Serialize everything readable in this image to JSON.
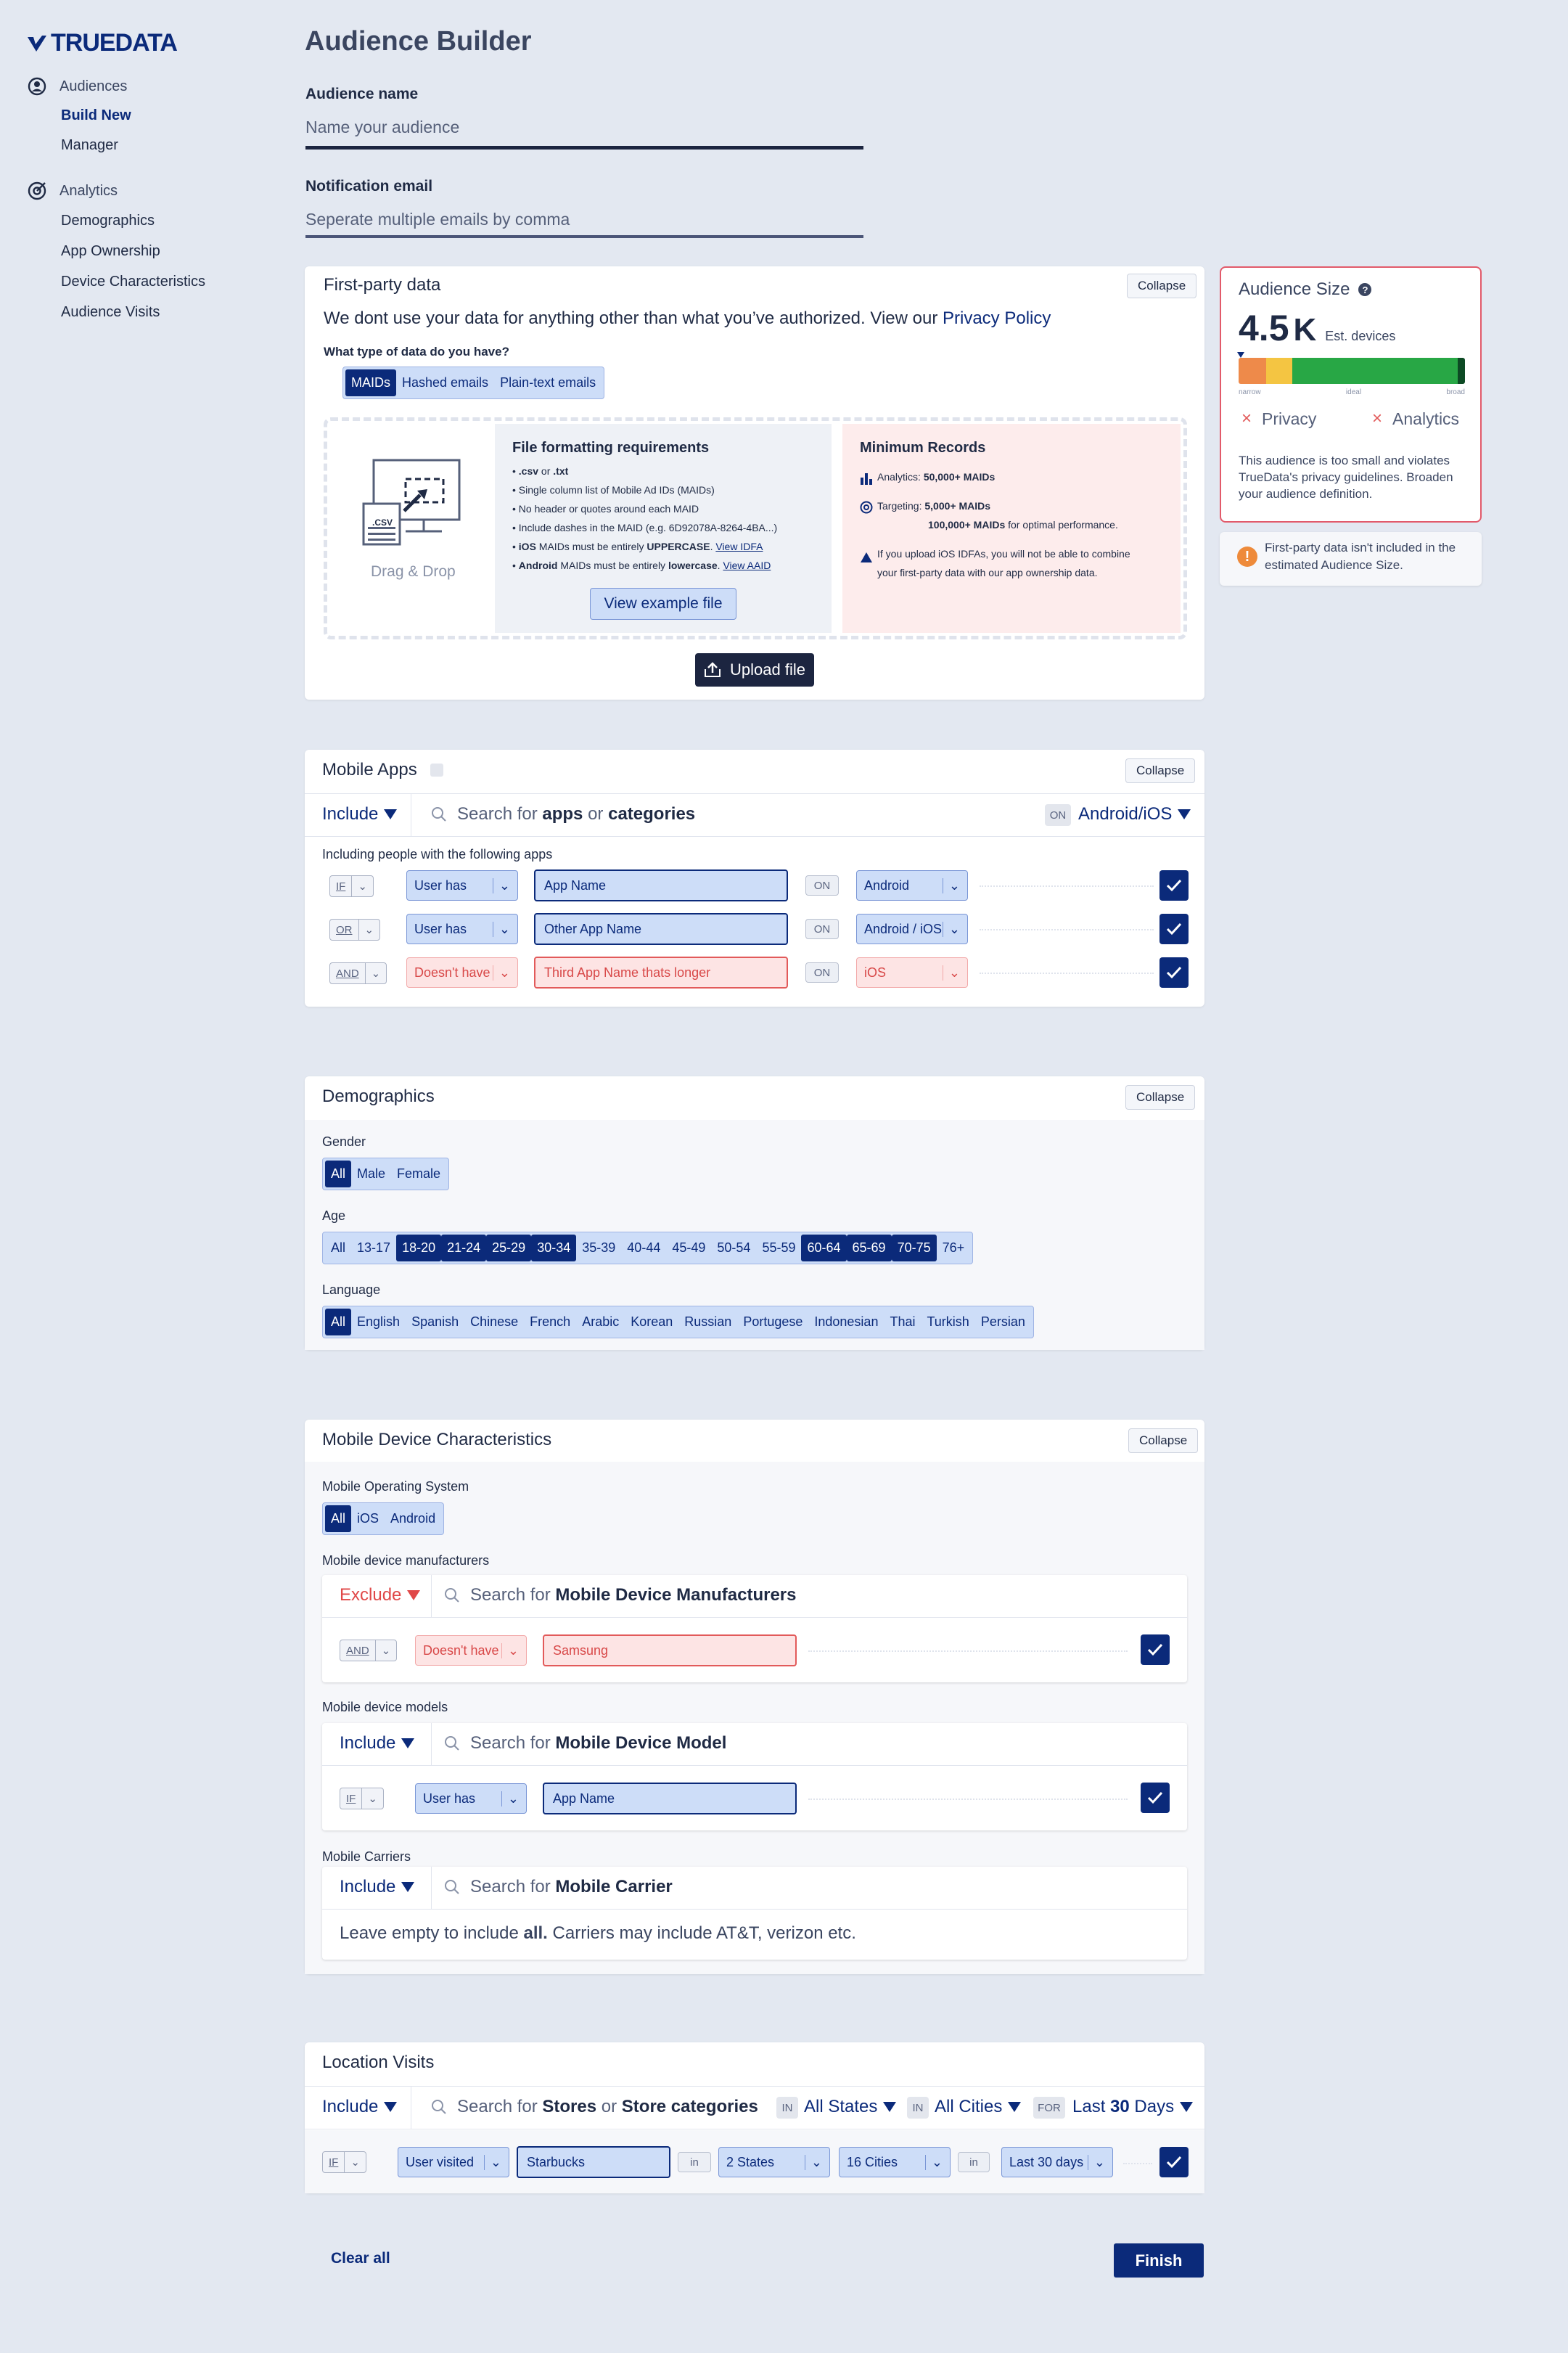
{
  "brand": {
    "logo_text": "TRUEDATA"
  },
  "sidebar": {
    "audiences": {
      "label": "Audiences",
      "items": [
        "Build New",
        "Manager"
      ]
    },
    "analytics": {
      "label": "Analytics",
      "items": [
        "Demographics",
        "App Ownership",
        "Device Characteristics",
        "Audience Visits"
      ]
    }
  },
  "page": {
    "title": "Audience Builder"
  },
  "form": {
    "audience_name": {
      "label": "Audience name",
      "placeholder": "Name your audience"
    },
    "notification_email": {
      "label": "Notification email",
      "placeholder": "Seperate multiple emails by comma"
    }
  },
  "first_party": {
    "title": "First-party data",
    "collapse": "Collapse",
    "desc": "We dont use your data for anything other than what you’ve authorized. View our",
    "privacy_link": "Privacy Policy",
    "question": "What type of data do you have?",
    "types": [
      "MAIDs",
      "Hashed emails",
      "Plain-text emails"
    ],
    "drop_label": "Drag & Drop",
    "csv_label": ".CSV",
    "req_title": "File formatting requirements",
    "req_items": [
      {
        "a": "•",
        "b": ".csv",
        "c": " or ",
        "d": ".txt"
      },
      {
        "a": "•",
        "text": "Single column list of Mobile Ad IDs (MAIDs)"
      },
      {
        "a": "•",
        "text": "No header or quotes around each MAID"
      },
      {
        "a": "•",
        "text": "Include dashes in the MAID (e.g. 6D92078A-8264-4BA...)"
      }
    ],
    "ios_line": {
      "b1": "iOS",
      "t1": " MAIDs must be entirely ",
      "b2": "UPPERCASE",
      "t2": ". ",
      "link": "View IDFA"
    },
    "android_line": {
      "b1": "Android",
      "t1": " MAIDs must be entirely ",
      "b2": "lowercase",
      "t2": ". ",
      "link": "View AAID"
    },
    "example_btn": "View example file",
    "min_title": "Minimum Records",
    "min_analytics": {
      "t": "Analytics: ",
      "b": "50,000+ MAIDs"
    },
    "min_targeting": {
      "t": "Targeting: ",
      "b": "5,000+ MAIDs"
    },
    "min_optimal": {
      "b": "100,000+ MAIDs",
      "t": " for optimal performance."
    },
    "min_warning_1": "If you upload iOS IDFAs, you will not be able to combine",
    "min_warning_2": "your first-party data with our app ownership data.",
    "upload_btn": "Upload file"
  },
  "audience_size": {
    "title": "Audience Size",
    "value": "4.5",
    "unit": "K",
    "unit_label": "Est. devices",
    "scale": [
      "narrow",
      "ideal",
      "broad"
    ],
    "privacy": "Privacy",
    "analytics": "Analytics",
    "message": "This audience is too small and violates TrueData's privacy guidelines. Broaden your audience definition.",
    "note": "First-party data isn't included in the estimated Audience Size."
  },
  "mobile_apps": {
    "title": "Mobile Apps",
    "collapse": "Collapse",
    "include": "Include",
    "search_pre": "Search for ",
    "search_b1": "apps",
    "search_mid": " or ",
    "search_b2": "categories",
    "on": "ON",
    "platform": "Android/iOS",
    "sub": "Including people with the following apps",
    "rows": [
      {
        "op": "IF",
        "cond": "User has",
        "app": "App Name",
        "on": "ON",
        "os": "Android",
        "red": false
      },
      {
        "op": "OR",
        "cond": "User has",
        "app": "Other App Name",
        "on": "ON",
        "os": "Android / iOS",
        "red": false
      },
      {
        "op": "AND",
        "cond": "Doesn't have",
        "app": "Third App Name thats longer",
        "on": "ON",
        "os": "iOS",
        "red": true
      }
    ]
  },
  "demographics": {
    "title": "Demographics",
    "collapse": "Collapse",
    "gender_label": "Gender",
    "gender": [
      "All",
      "Male",
      "Female"
    ],
    "age_label": "Age",
    "age": [
      "All",
      "13-17",
      "18-20",
      "21-24",
      "25-29",
      "30-34",
      "35-39",
      "40-44",
      "45-49",
      "50-54",
      "55-59",
      "60-64",
      "65-69",
      "70-75",
      "76+"
    ],
    "language_label": "Language",
    "language": [
      "All",
      "English",
      "Spanish",
      "Chinese",
      "French",
      "Arabic",
      "Korean",
      "Russian",
      "Portugese",
      "Indonesian",
      "Thai",
      "Turkish",
      "Persian"
    ]
  },
  "device": {
    "title": "Mobile Device Characteristics",
    "collapse": "Collapse",
    "os_label": "Mobile Operating System",
    "os": [
      "All",
      "iOS",
      "Android"
    ],
    "mfr_label": "Mobile device manufacturers",
    "mfr_mode": "Exclude",
    "mfr_search_pre": "Search for ",
    "mfr_search_b": "Mobile Device Manufacturers",
    "mfr_row": {
      "op": "AND",
      "cond": "Doesn't have",
      "value": "Samsung"
    },
    "model_label": "Mobile device models",
    "model_mode": "Include",
    "model_search_pre": "Search for ",
    "model_search_b": "Mobile Device Model",
    "model_row": {
      "op": "IF",
      "cond": "User has",
      "value": "App Name"
    },
    "carrier_label": "Mobile Carriers",
    "carrier_mode": "Include",
    "carrier_search_pre": "Search for ",
    "carrier_search_b": "Mobile Carrier",
    "carrier_hint_pre": "Leave empty to include ",
    "carrier_hint_b": "all.",
    "carrier_hint_post": " Carriers may include AT&T, verizon etc."
  },
  "location": {
    "title": "Location Visits",
    "include": "Include",
    "search_pre": "Search for ",
    "search_b1": "Stores",
    "search_mid": " or ",
    "search_b2": "Store categories",
    "in1": "IN",
    "states": "All States",
    "in2": "IN",
    "cities": "All Cities",
    "for": "FOR",
    "period_pre": "Last ",
    "period_b": "30",
    "period_post": " Days",
    "row": {
      "op": "IF",
      "cond": "User visited",
      "store": "Starbucks",
      "in1": "in",
      "states": "2 States",
      "cities": "16 Cities",
      "in2": "in",
      "days": "Last 30 days"
    }
  },
  "footer": {
    "clear": "Clear all",
    "finish": "Finish"
  }
}
